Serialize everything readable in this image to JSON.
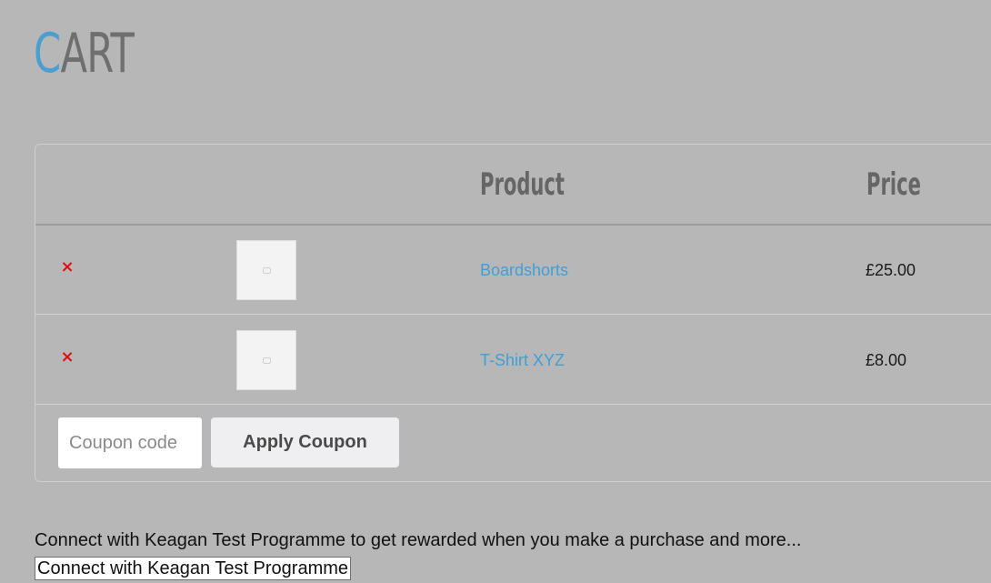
{
  "title": {
    "accent_letter": "C",
    "rest": "ART"
  },
  "table": {
    "headers": {
      "product": "Product",
      "price": "Price"
    },
    "rows": [
      {
        "remove_icon": "×",
        "thumbnail_icon": "image-placeholder-icon",
        "product": "Boardshorts",
        "price": "£25.00"
      },
      {
        "remove_icon": "×",
        "thumbnail_icon": "image-placeholder-icon",
        "product": "T-Shirt XYZ",
        "price": "£8.00"
      }
    ]
  },
  "coupon": {
    "placeholder": "Coupon code",
    "apply_label": "Apply Coupon"
  },
  "rewards": {
    "message": "Connect with Keagan Test Programme to get rewarded when you make a purchase and more...",
    "button_label": "Connect with Keagan Test Programme"
  },
  "colors": {
    "background": "#b7b7b7",
    "accent": "#4a9fd0",
    "link": "#3f9fd6",
    "remove": "#e01010"
  }
}
